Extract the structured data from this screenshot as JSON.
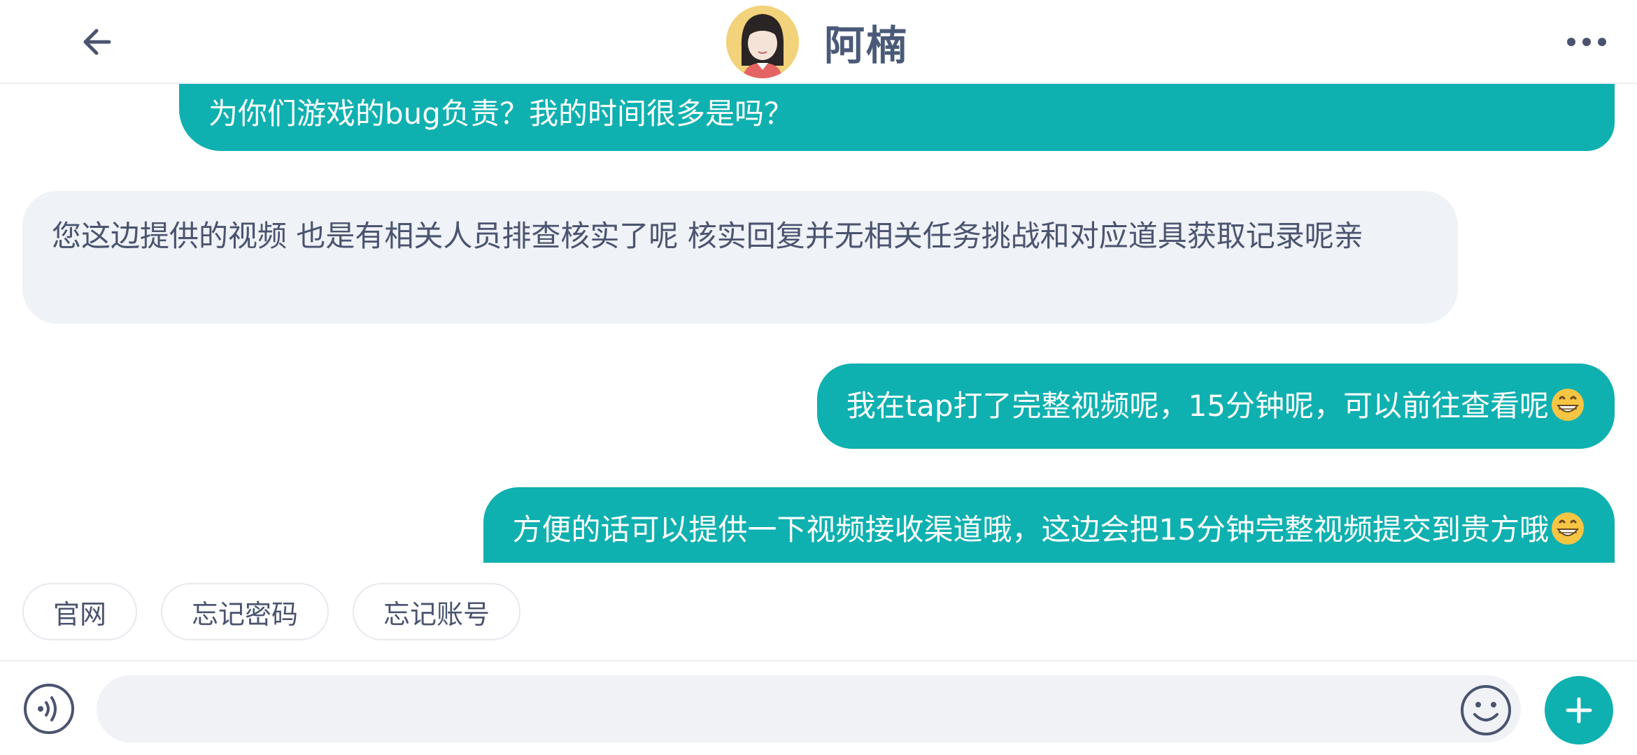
{
  "header": {
    "contact_name": "阿楠",
    "back_icon": "arrow-left-icon",
    "more_icon": "more-horizontal-icon"
  },
  "messages": [
    {
      "side": "out",
      "text": "为你们游戏的bug负责？我的时间很多是吗？"
    },
    {
      "side": "in",
      "text": "您这边提供的视频 也是有相关人员排查核实了呢 核实回复并无相关任务挑战和对应道具获取记录呢亲"
    },
    {
      "side": "out",
      "text": "我在tap打了完整视频呢，15分钟呢，可以前往查看呢",
      "emoji": "grinning-face"
    },
    {
      "side": "out",
      "text": "方便的话可以提供一下视频接收渠道哦，这边会把15分钟完整视频提交到贵方哦",
      "emoji": "grinning-face"
    }
  ],
  "quick_replies": [
    "官网",
    "忘记密码",
    "忘记账号"
  ],
  "input_bar": {
    "placeholder": "",
    "value": ""
  },
  "colors": {
    "accent": "#0fb0b0",
    "incoming_bubble": "#eff2f6",
    "text_dark": "#4a5470"
  }
}
